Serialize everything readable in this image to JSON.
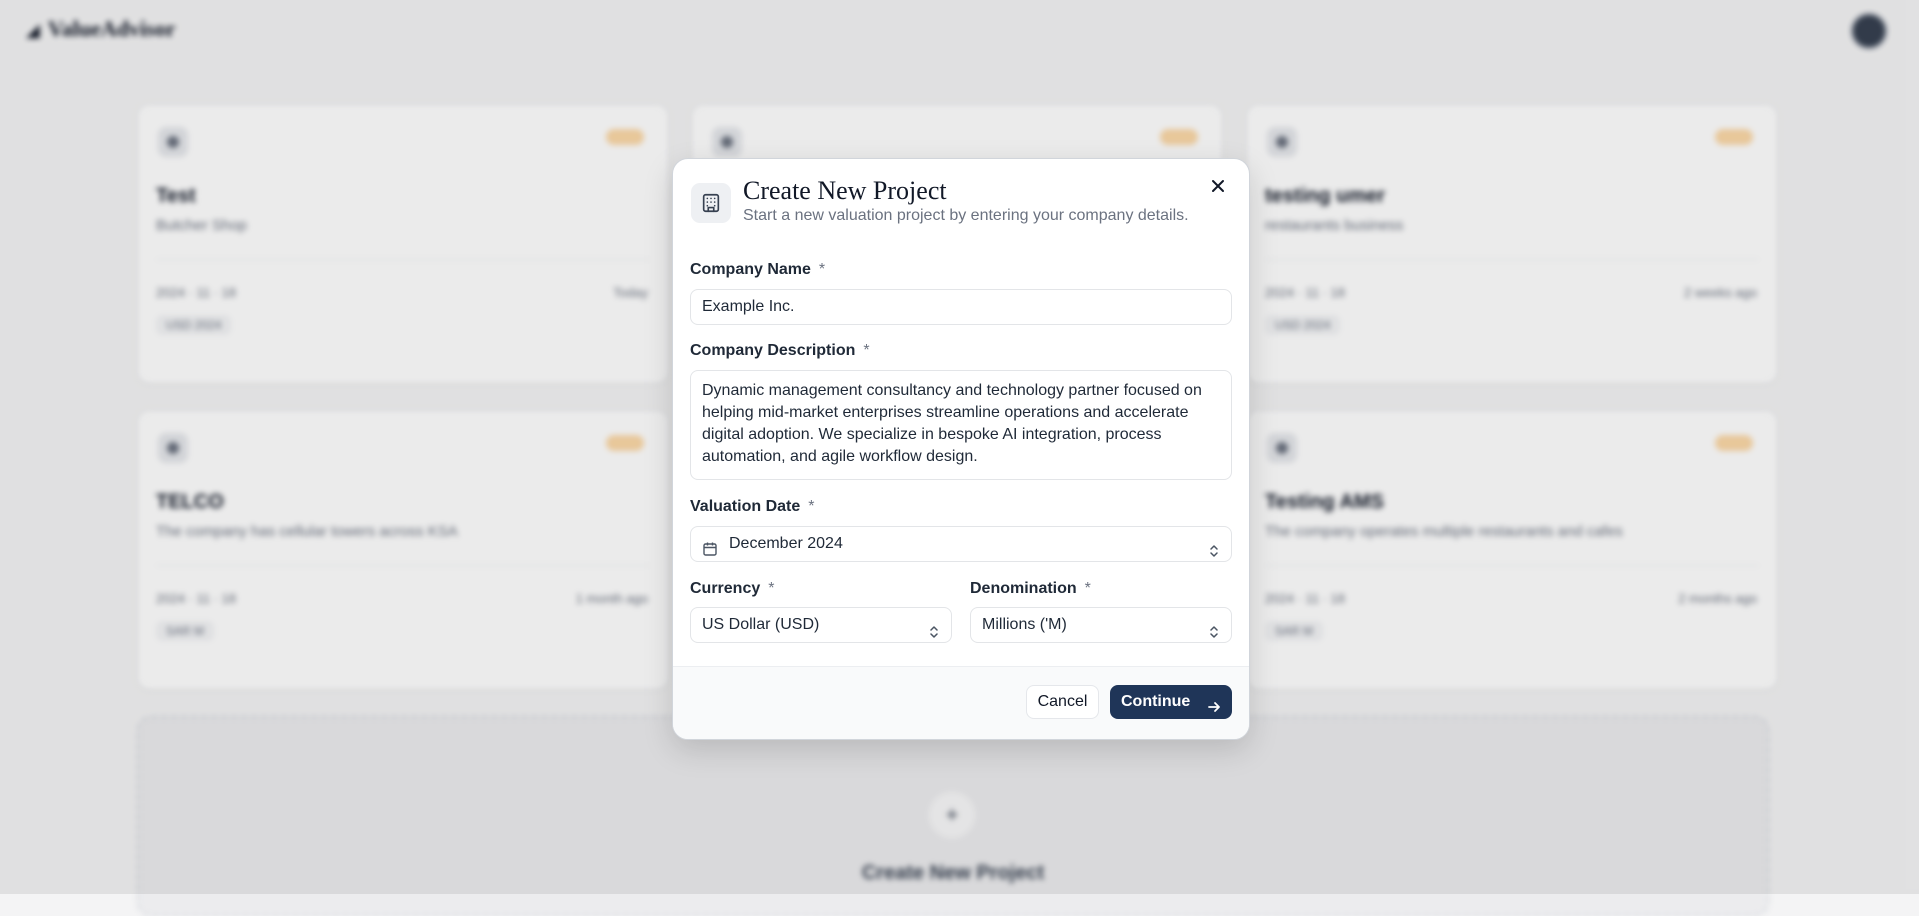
{
  "app": {
    "logo_text": "ValueAdvisor"
  },
  "cards": [
    {
      "title": "Test",
      "desc": "Butcher Shop",
      "date": "2024 · 11 · 18",
      "ago": "Today",
      "tag": "USD 2024"
    },
    {
      "title": "",
      "desc": "",
      "date": "",
      "ago": "",
      "tag": ""
    },
    {
      "title": "testing umer",
      "desc": "restaurants business",
      "date": "2024 · 11 · 18",
      "ago": "2 weeks ago",
      "tag": "USD 2024"
    },
    {
      "title": "TELCO",
      "desc": "The company has cellular towers across KSA",
      "date": "2024 · 11 · 18",
      "ago": "1 month ago",
      "tag": "SAR M"
    },
    {
      "title": "Testing AMS",
      "desc": "The company operates multiple restaurants and cafes",
      "date": "2024 · 11 · 18",
      "ago": "2 months ago",
      "tag": "SAR M"
    }
  ],
  "create_card": {
    "label": "Create New Project",
    "icon": "plus-icon"
  },
  "modal": {
    "title": "Create New Project",
    "subtitle": "Start a new valuation project by entering your company details.",
    "required_mark": "*",
    "company_name": {
      "label": "Company Name",
      "value": "Example Inc."
    },
    "company_description": {
      "label": "Company Description",
      "value": "Dynamic management consultancy and technology partner focused on helping mid-market enterprises streamline operations and accelerate digital adoption. We specialize in bespoke AI integration, process automation, and agile workflow design."
    },
    "valuation_date": {
      "label": "Valuation Date",
      "value": "December 2024"
    },
    "currency": {
      "label": "Currency",
      "value": "US Dollar (USD)"
    },
    "denomination": {
      "label": "Denomination",
      "value": "Millions ('M)"
    },
    "cancel_label": "Cancel",
    "continue_label": "Continue",
    "accent_color": "#1f3558"
  }
}
